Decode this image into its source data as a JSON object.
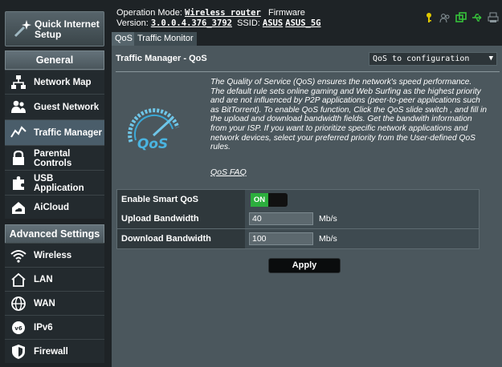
{
  "sidebar": {
    "quick_internet_setup": "Quick Internet Setup",
    "general_header": "General",
    "general_items": [
      {
        "label": "Network Map",
        "icon": "network-map-icon"
      },
      {
        "label": "Guest Network",
        "icon": "guest-network-icon"
      },
      {
        "label": "Traffic Manager",
        "icon": "traffic-manager-icon",
        "active": true
      },
      {
        "label": "Parental Controls",
        "icon": "lock-icon"
      },
      {
        "label": "USB Application",
        "icon": "puzzle-icon"
      },
      {
        "label": "AiCloud",
        "icon": "cloud-house-icon"
      }
    ],
    "advanced_header": "Advanced Settings",
    "advanced_items": [
      {
        "label": "Wireless",
        "icon": "wifi-icon"
      },
      {
        "label": "LAN",
        "icon": "house-icon"
      },
      {
        "label": "WAN",
        "icon": "globe-icon"
      },
      {
        "label": "IPv6",
        "icon": "ipv6-icon"
      },
      {
        "label": "Firewall",
        "icon": "shield-icon"
      }
    ]
  },
  "header": {
    "operation_mode_label": "Operation Mode:",
    "operation_mode_value": "Wireless router",
    "firmware_label": "Firmware",
    "version_label": "Version:",
    "version_value": "3.0.0.4.376_3792",
    "ssid_label": "SSID:",
    "ssid_1": "ASUS",
    "ssid_2": "ASUS_5G"
  },
  "tabs": [
    {
      "label": "QoS",
      "active": true
    },
    {
      "label": "Traffic Monitor",
      "active": false
    }
  ],
  "panel": {
    "title": "Traffic Manager - QoS",
    "dropdown_value": "QoS to configuration",
    "description": "The Quality of Service (QoS) ensures the network's speed performance. The default rule sets online gaming and Web Surfing as the highest priority and are not influenced by P2P applications (peer-to-peer applications such as BitTorrent). To enable QoS function, Click the QoS slide switch , and fill in the upload and download bandwidth fields. Get the bandwith information from your ISP. If you want to prioritize specific network applications and network devices, select your preferred priority from the User-defined QoS rules.",
    "faq_link": "QoS FAQ",
    "gauge_label": "QoS"
  },
  "settings": {
    "smart_qos_label": "Enable Smart QoS",
    "smart_qos_state": "ON",
    "upload_label": "Upload Bandwidth",
    "upload_value": "40",
    "upload_unit": "Mb/s",
    "download_label": "Download Bandwidth",
    "download_value": "100",
    "download_unit": "Mb/s",
    "apply_label": "Apply"
  },
  "colors": {
    "accent_green": "#2cae3d",
    "status_yellow": "#e0c800",
    "status_green": "#36c23a",
    "panel_bg": "#4b575d"
  }
}
